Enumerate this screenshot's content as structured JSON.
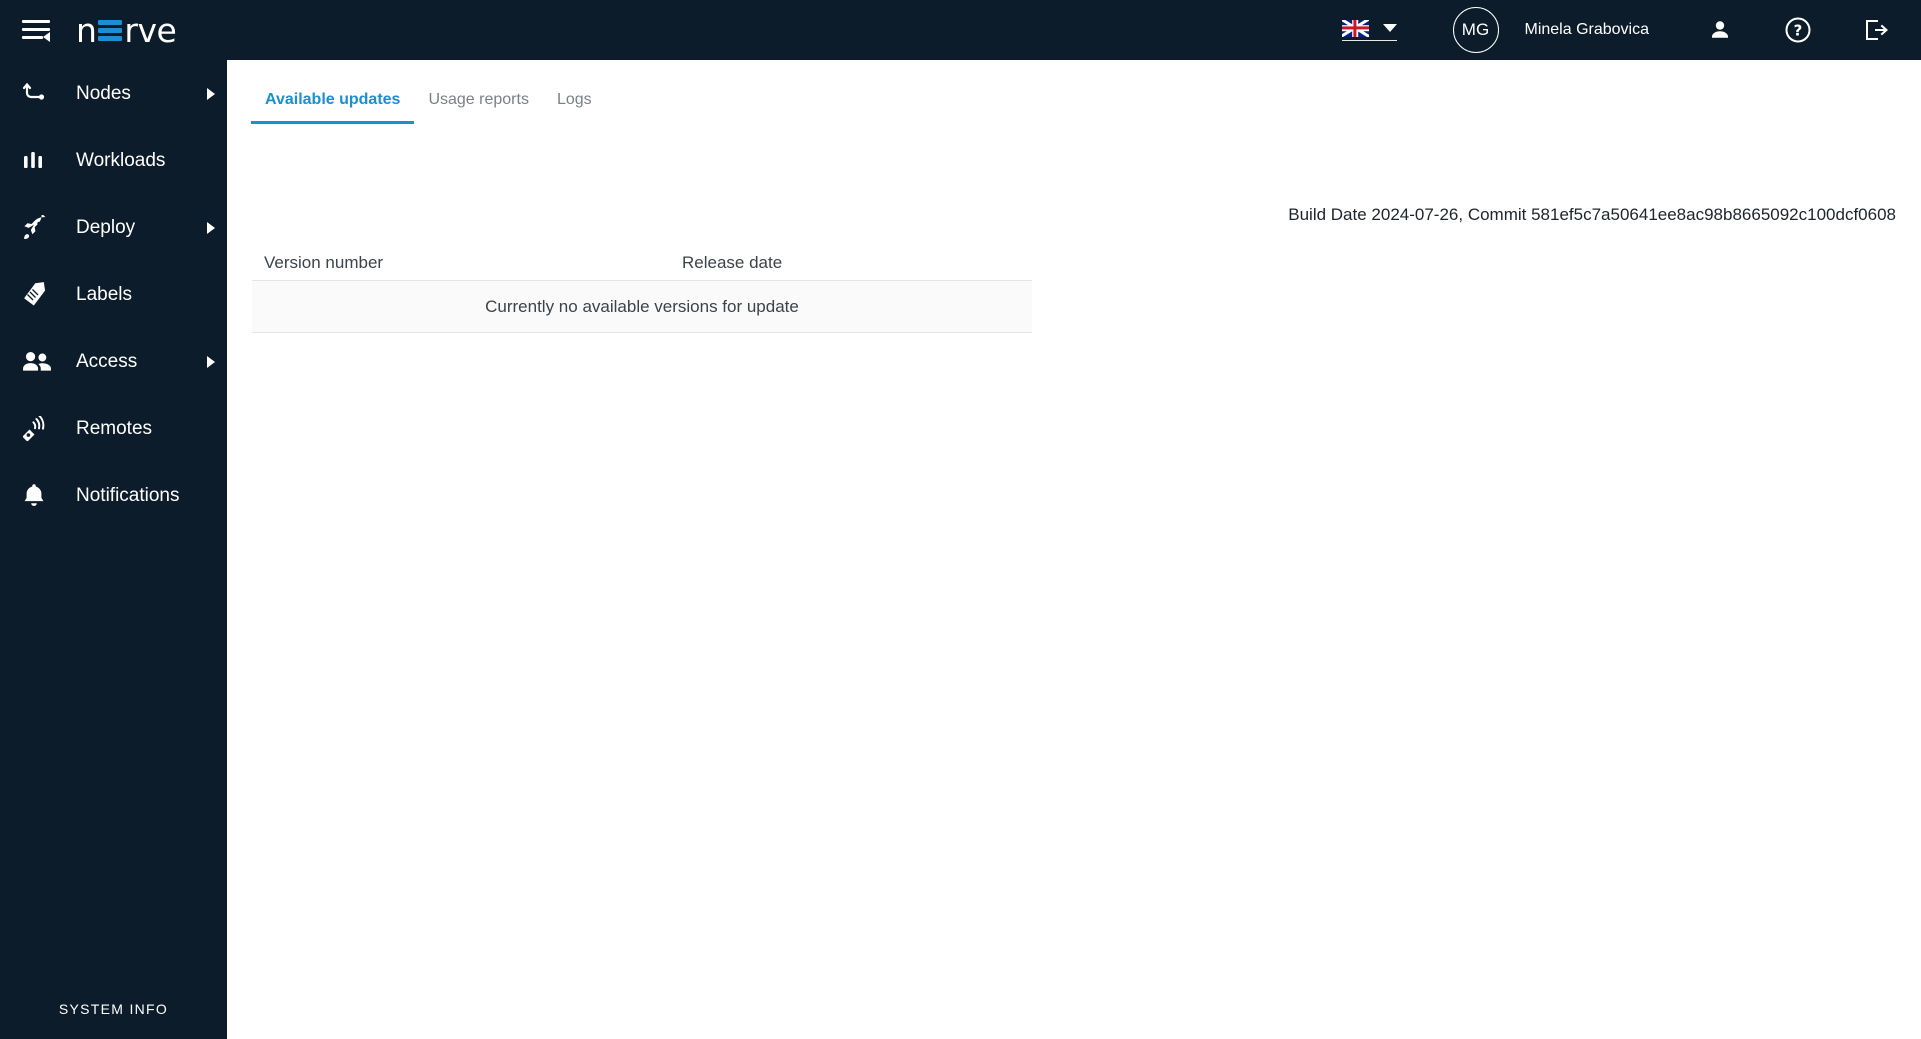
{
  "header": {
    "menu_toggle_icon": "hamburger-collapse-icon",
    "logo_text_before": "n",
    "logo_text_after": "rve",
    "language": {
      "flag": "uk-flag-icon",
      "selected": "English",
      "caret_icon": "chevron-down-icon"
    },
    "avatar_initials": "MG",
    "username": "Minela Grabovica",
    "person_icon": "person-icon",
    "help_icon": "question-mark-circle-icon",
    "logout_icon": "logout-icon"
  },
  "sidebar": {
    "items": [
      {
        "label": "Nodes",
        "icon": "nodes-icon",
        "expandable": true
      },
      {
        "label": "Workloads",
        "icon": "workloads-icon",
        "expandable": false
      },
      {
        "label": "Deploy",
        "icon": "rocket-icon",
        "expandable": true
      },
      {
        "label": "Labels",
        "icon": "tag-icon",
        "expandable": false
      },
      {
        "label": "Access",
        "icon": "people-icon",
        "expandable": true
      },
      {
        "label": "Remotes",
        "icon": "remote-signal-icon",
        "expandable": false
      },
      {
        "label": "Notifications",
        "icon": "bell-icon",
        "expandable": false
      }
    ],
    "footer_label": "SYSTEM INFO"
  },
  "main": {
    "tabs": [
      {
        "label": "Available updates",
        "active": true
      },
      {
        "label": "Usage reports",
        "active": false
      },
      {
        "label": "Logs",
        "active": false
      }
    ],
    "build_info": "Build Date 2024-07-26, Commit 581ef5c7a50641ee8ac98b8665092c100dcf0608",
    "table": {
      "columns": [
        "Version number",
        "Release date"
      ],
      "rows": [],
      "empty_message": "Currently no available versions for update"
    }
  },
  "colors": {
    "sidebar_bg": "#0c1c2a",
    "accent": "#1a8fd1",
    "tab_inactive": "#7b8087",
    "empty_row_bg": "#fafafa"
  }
}
